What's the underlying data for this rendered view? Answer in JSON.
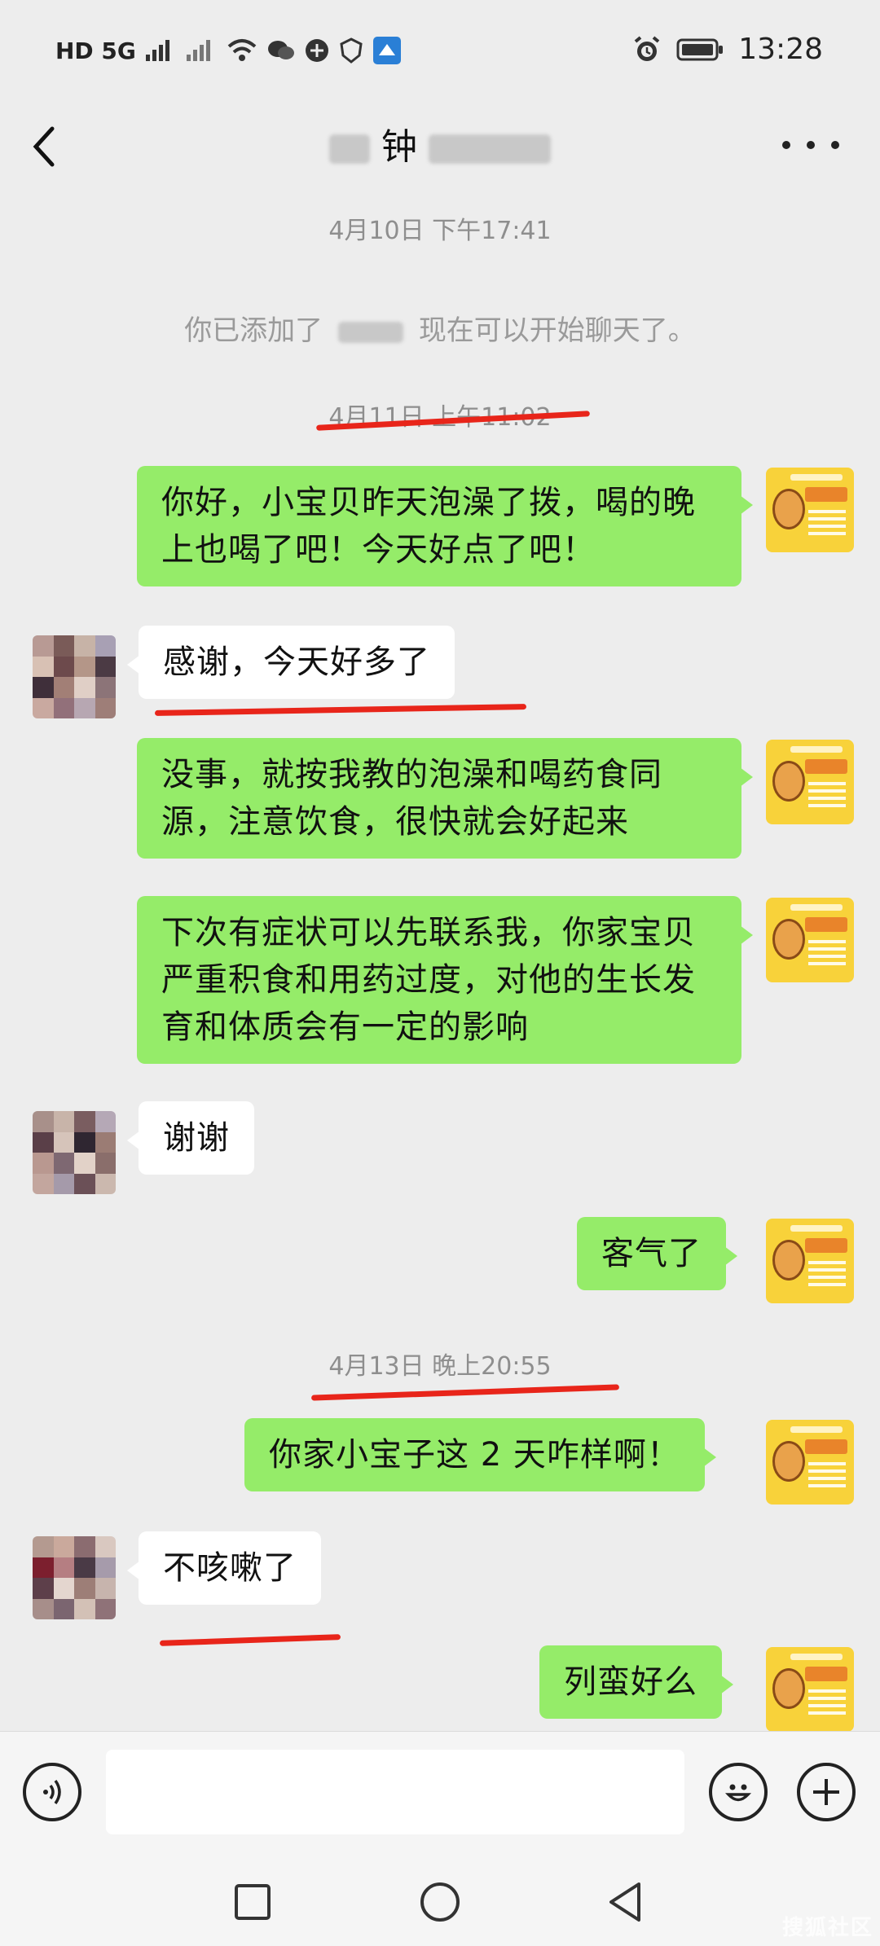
{
  "status_bar": {
    "left_indicators": "HD 5G",
    "time": "13:28"
  },
  "header": {
    "title": "钟"
  },
  "timestamps": [
    "4月10日 下午17:41",
    "4月11日 上午11:02",
    "4月13日 晚上20:55"
  ],
  "system_message": {
    "prefix": "你已添加了",
    "suffix": "现在可以开始聊天了。"
  },
  "messages": [
    {
      "sender": "me",
      "text": "你好，小宝贝昨天泡澡了拨，喝的晚上也喝了吧！今天好点了吧！"
    },
    {
      "sender": "them",
      "text": "感谢，今天好多了"
    },
    {
      "sender": "me",
      "text": "没事，就按我教的泡澡和喝药食同源，注意饮食，很快就会好起来"
    },
    {
      "sender": "me",
      "text": "下次有症状可以先联系我，你家宝贝严重积食和用药过度，对他的生长发育和体质会有一定的影响"
    },
    {
      "sender": "them",
      "text": "谢谢"
    },
    {
      "sender": "me",
      "text": "客气了"
    },
    {
      "sender": "me",
      "text": "你家小宝子这 2 天咋样啊！"
    },
    {
      "sender": "them",
      "text": "不咳嗽了"
    },
    {
      "sender": "me",
      "text": "列蛮好么"
    }
  ],
  "input": {
    "placeholder": ""
  },
  "watermark": "搜狐社区",
  "colors": {
    "my_bubble": "#95ec69",
    "their_bubble": "#ffffff",
    "background": "#ededed",
    "annotation_red": "#e8251a"
  }
}
